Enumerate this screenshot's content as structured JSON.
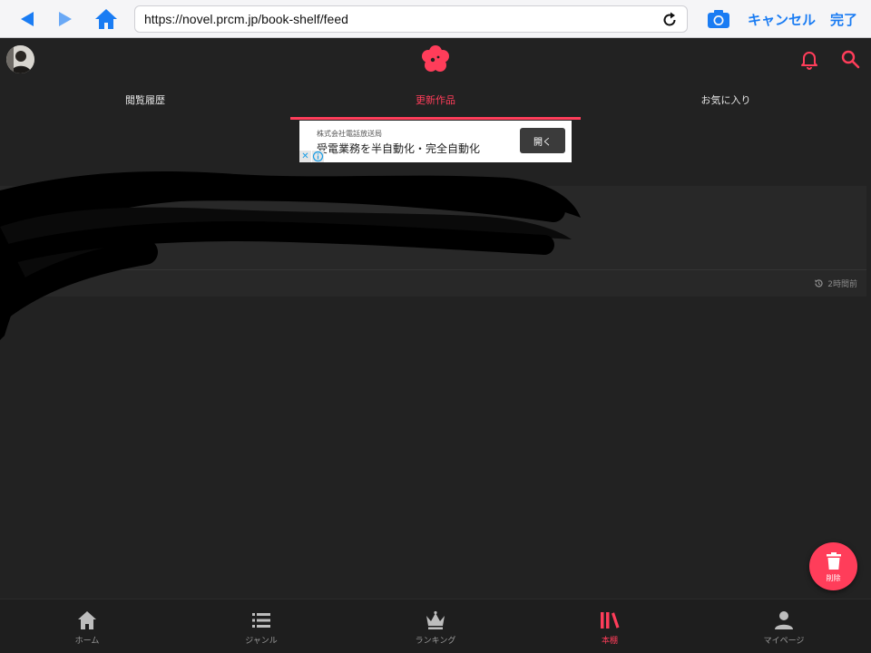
{
  "browser": {
    "url": "https://novel.prcm.jp/book-shelf/feed",
    "cancel_label": "キャンセル",
    "done_label": "完了",
    "accent": "#1a7cf3"
  },
  "header": {
    "logo_icon": "flower-logo-icon",
    "accent": "#ff3d5a"
  },
  "tabs": [
    {
      "label": "閲覧履歴",
      "active": false
    },
    {
      "label": "更新作品",
      "active": true
    },
    {
      "label": "お気に入り",
      "active": false
    }
  ],
  "ad": {
    "company": "株式会社電話放送局",
    "headline": "受電業務を半自動化・完全自動化",
    "open_label": "開く"
  },
  "feed": {
    "items": [
      {
        "time": "2時間前"
      }
    ]
  },
  "fab": {
    "label": "削除"
  },
  "bottom_nav": [
    {
      "label": "ホーム",
      "icon": "home-icon",
      "active": false
    },
    {
      "label": "ジャンル",
      "icon": "list-icon",
      "active": false
    },
    {
      "label": "ランキング",
      "icon": "crown-icon",
      "active": false
    },
    {
      "label": "本棚",
      "icon": "bookshelf-icon",
      "active": true
    },
    {
      "label": "マイページ",
      "icon": "person-icon",
      "active": false
    }
  ]
}
